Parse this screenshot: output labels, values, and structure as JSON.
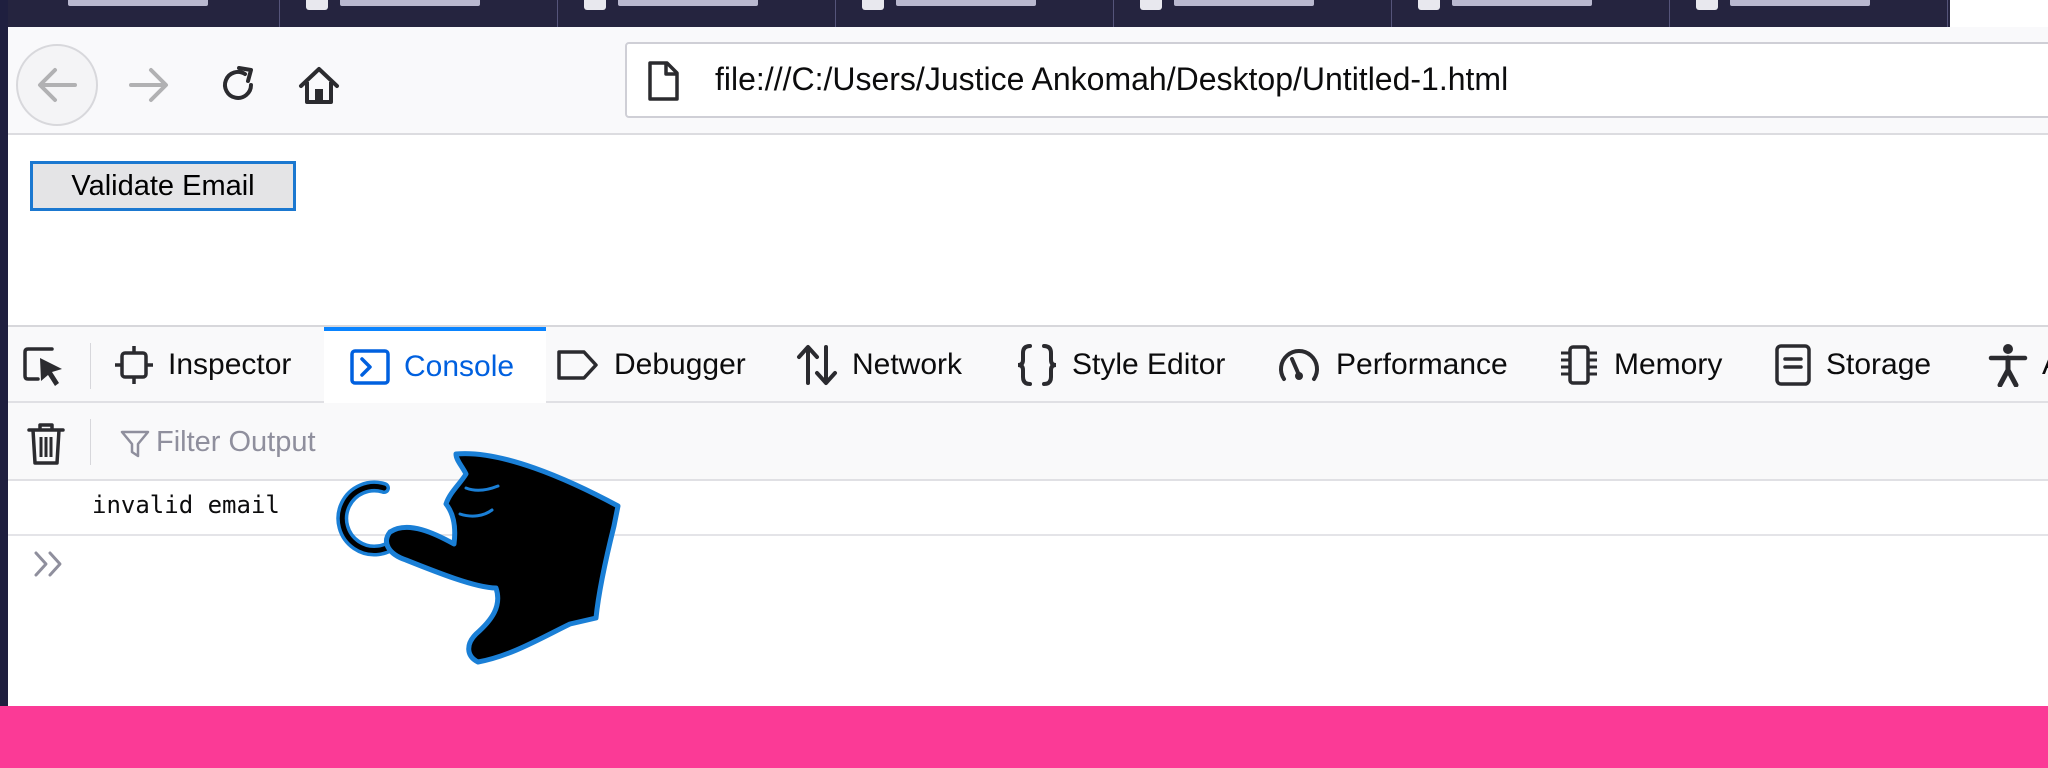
{
  "browser": {
    "nav": {
      "back_icon": "arrow-left-icon",
      "forward_icon": "arrow-right-icon",
      "reload_icon": "reload-icon",
      "home_icon": "home-icon"
    },
    "url": "file:///C:/Users/Justice Ankomah/Desktop/Untitled-1.html"
  },
  "page": {
    "validate_button_label": "Validate Email"
  },
  "devtools": {
    "tabs": [
      {
        "label": "Inspector",
        "icon": "inspector-icon"
      },
      {
        "label": "Console",
        "icon": "console-icon",
        "active": true
      },
      {
        "label": "Debugger",
        "icon": "debugger-icon"
      },
      {
        "label": "Network",
        "icon": "network-icon"
      },
      {
        "label": "Style Editor",
        "icon": "braces-icon"
      },
      {
        "label": "Performance",
        "icon": "gauge-icon"
      },
      {
        "label": "Memory",
        "icon": "memory-chip-icon"
      },
      {
        "label": "Storage",
        "icon": "storage-icon"
      },
      {
        "label": "A",
        "icon": "accessibility-icon"
      }
    ],
    "console": {
      "filter_placeholder": "Filter Output",
      "messages": [
        "invalid email"
      ]
    }
  },
  "colors": {
    "accent": "#0a84ff",
    "active_tab_text": "#0060df",
    "bottom_band": "#fb3a96",
    "tab_strip": "#25243f"
  }
}
